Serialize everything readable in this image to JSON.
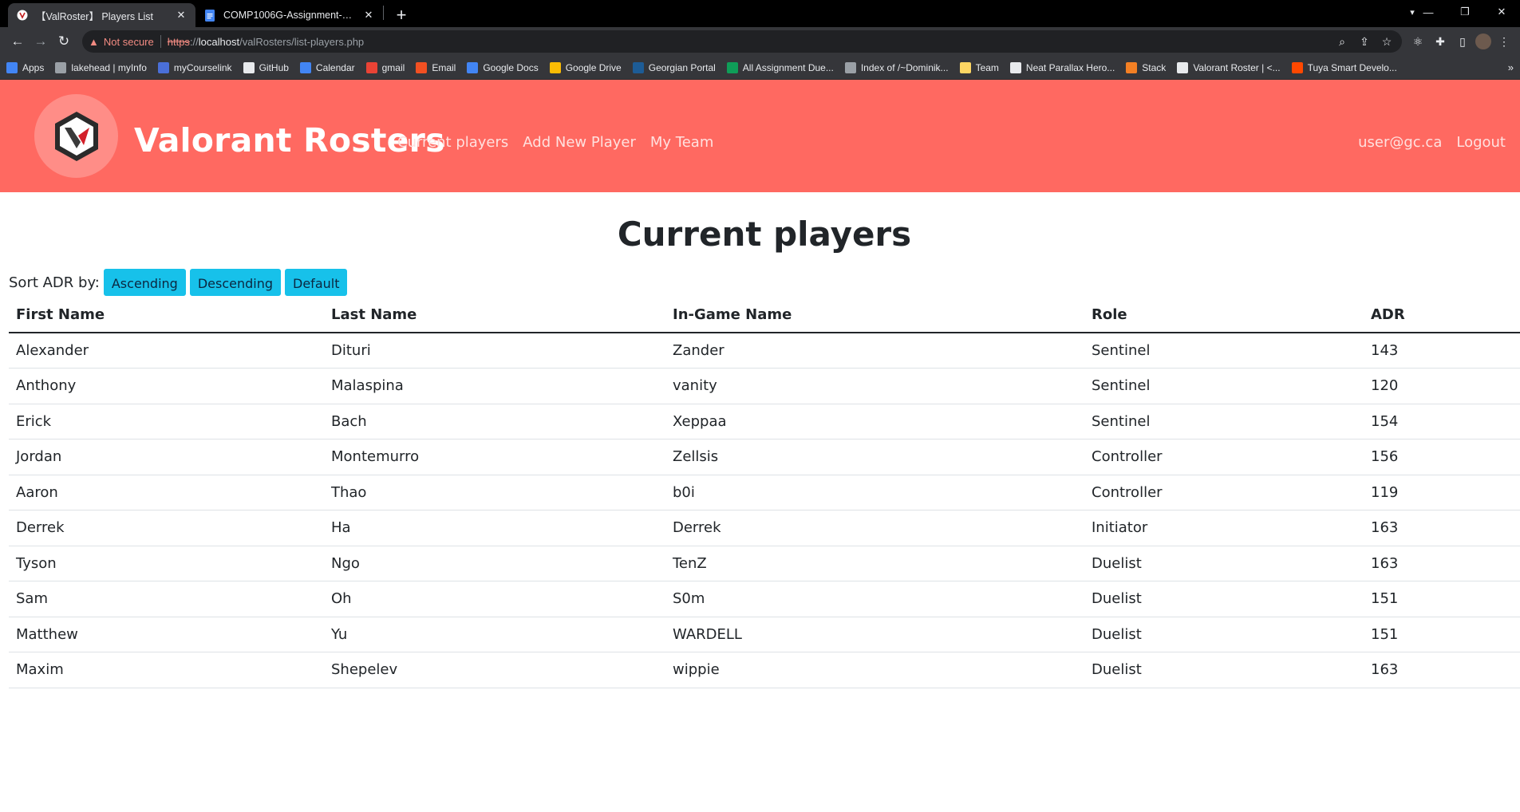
{
  "browser": {
    "tabs": [
      {
        "title": "【ValRoster】 Players List",
        "active": true
      },
      {
        "title": "COMP1006G-Assignment-2-Opt",
        "active": false
      }
    ],
    "security_label": "Not secure",
    "url": {
      "scheme": "https",
      "sep": "://",
      "host": "localhost",
      "path": "/valRosters/list-players.php"
    },
    "bookmarks": [
      {
        "label": "Apps",
        "icon": "apps-grid-icon",
        "color": "#4285f4"
      },
      {
        "label": "lakehead | myInfo",
        "icon": "globe-icon",
        "color": "#9aa0a6"
      },
      {
        "label": "myCourselink",
        "icon": "courselink-icon",
        "color": "#4a6fd8"
      },
      {
        "label": "GitHub",
        "icon": "github-icon",
        "color": "#e8eaed"
      },
      {
        "label": "Calendar",
        "icon": "calendar-icon",
        "color": "#4285f4"
      },
      {
        "label": "gmail",
        "icon": "gmail-icon",
        "color": "#ea4335"
      },
      {
        "label": "Email",
        "icon": "microsoft-icon",
        "color": "#f25022"
      },
      {
        "label": "Google Docs",
        "icon": "docs-icon",
        "color": "#4285f4"
      },
      {
        "label": "Google Drive",
        "icon": "drive-icon",
        "color": "#fbbc04"
      },
      {
        "label": "Georgian Portal",
        "icon": "portal-icon",
        "color": "#1d5c96"
      },
      {
        "label": "All Assignment Due...",
        "icon": "sheets-icon",
        "color": "#0f9d58"
      },
      {
        "label": "Index of /~Dominik...",
        "icon": "globe-icon",
        "color": "#9aa0a6"
      },
      {
        "label": "Team",
        "icon": "folder-icon",
        "color": "#fdd663"
      },
      {
        "label": "Neat Parallax Hero...",
        "icon": "codepen-icon",
        "color": "#e8eaed"
      },
      {
        "label": "Stack",
        "icon": "stackoverflow-icon",
        "color": "#f48024"
      },
      {
        "label": "Valorant Roster | <...",
        "icon": "valorant-icon",
        "color": "#e8eaed"
      },
      {
        "label": "Tuya Smart Develo...",
        "icon": "tuya-icon",
        "color": "#ff4800"
      }
    ],
    "bookmarks_more": "»"
  },
  "site": {
    "brand": "Valorant Rosters",
    "nav": [
      "Current players",
      "Add New Player",
      "My Team"
    ],
    "user_email": "user@gc.ca",
    "logout": "Logout",
    "header_color": "#ff6961"
  },
  "main": {
    "title": "Current players",
    "sort_label": "Sort ADR by:",
    "sort_buttons": [
      "Ascending",
      "Descending",
      "Default"
    ],
    "columns": [
      "First Name",
      "Last Name",
      "In-Game Name",
      "Role",
      "ADR"
    ],
    "rows": [
      [
        "Alexander",
        "Dituri",
        "Zander",
        "Sentinel",
        "143"
      ],
      [
        "Anthony",
        "Malaspina",
        "vanity",
        "Sentinel",
        "120"
      ],
      [
        "Erick",
        "Bach",
        "Xeppaa",
        "Sentinel",
        "154"
      ],
      [
        "Jordan",
        "Montemurro",
        "Zellsis",
        "Controller",
        "156"
      ],
      [
        "Aaron",
        "Thao",
        "b0i",
        "Controller",
        "119"
      ],
      [
        "Derrek",
        "Ha",
        "Derrek",
        "Initiator",
        "163"
      ],
      [
        "Tyson",
        "Ngo",
        "TenZ",
        "Duelist",
        "163"
      ],
      [
        "Sam",
        "Oh",
        "S0m",
        "Duelist",
        "151"
      ],
      [
        "Matthew",
        "Yu",
        "WARDELL",
        "Duelist",
        "151"
      ],
      [
        "Maxim",
        "Shepelev",
        "wippie",
        "Duelist",
        "163"
      ]
    ]
  }
}
